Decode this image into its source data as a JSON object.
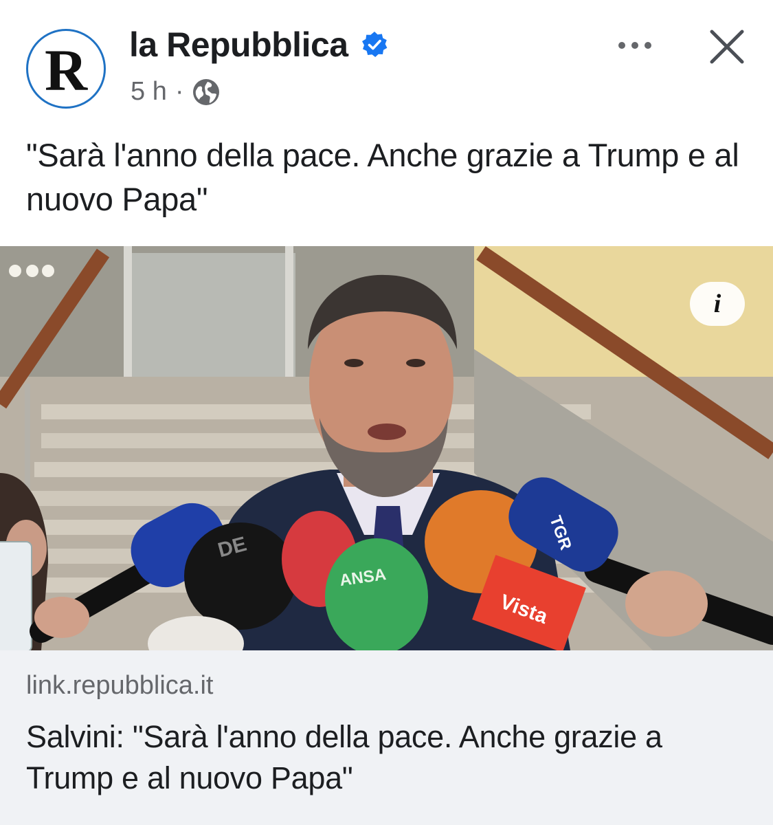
{
  "header": {
    "avatar_letter": "R",
    "page_name": "la Repubblica",
    "timestamp": "5 h",
    "separator": "·",
    "verified_icon": "verified-badge-icon",
    "audience_icon": "globe-icon"
  },
  "actions": {
    "more_icon": "more-dots-icon",
    "close_icon": "close-icon"
  },
  "post": {
    "message": "\"Sarà l'anno della pace. Anche grazie a Trump e al nuovo Papa\""
  },
  "photo": {
    "info_label": "i",
    "mic_labels": [
      "ANSA",
      "Vista",
      "TGR"
    ]
  },
  "link_preview": {
    "domain": "link.repubblica.it",
    "title": "Salvini: \"Sarà l'anno della pace. Anche grazie a Trump e al nuovo Papa\""
  },
  "colors": {
    "verified": "#1877f2",
    "avatar_ring": "#1f72c4",
    "secondary_text": "#65676b",
    "link_background": "#f0f2f5"
  }
}
